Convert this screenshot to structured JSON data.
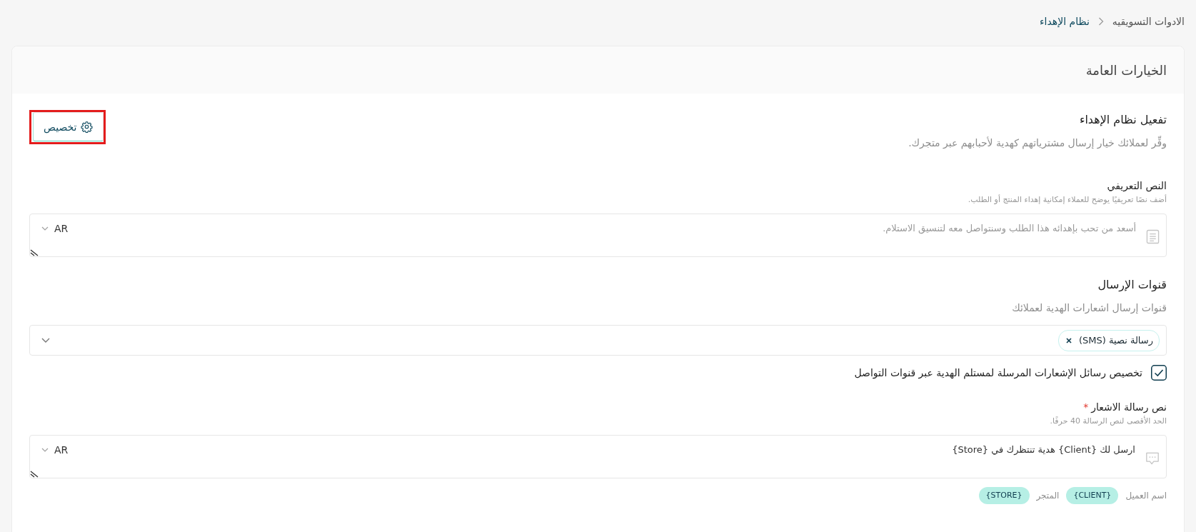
{
  "breadcrumb": [
    {
      "label": "الادوات التسويقيه",
      "current": false
    },
    {
      "label": "نظام الإهداء",
      "current": true
    }
  ],
  "card": {
    "title": "الخيارات العامة"
  },
  "activation": {
    "title": "تفعيل نظام الإهداء",
    "description": "وفِّر لعملائك خيار إرسال مشترياتهم كهدية لأحبابهم عبر متجرك.",
    "customize_button": {
      "label": "تخصيص",
      "highlighted": true
    }
  },
  "intro_text": {
    "label": "النص التعريفي",
    "hint": "أضف نصًا تعريفيًا يوضح للعملاء إمكانية إهداء المنتج أو الطلب.",
    "placeholder": "أسعد من تحب بإهدائه هذا الطلب وسنتواصل معه لتنسيق الاستلام.",
    "language": "AR"
  },
  "channels": {
    "title": "قنوات الإرسال",
    "description": "قنوات إرسال اشعارات الهدية لعملائك",
    "selected_tags": [
      {
        "label": "رسالة نصية (SMS)"
      }
    ],
    "customize_messages": {
      "label": "تخصيص رسائل الإشعارات المرسلة لمستلم الهدية عبر قنوات التواصل",
      "checked": true
    }
  },
  "notification_text": {
    "label": "نص رسالة الاشعار",
    "required_mark": "*",
    "hint": "الحد الأقصى لنص الرسالة 40 حرفًا.",
    "value": "ارسل لك {Client} هدية تنتظرك في {Store}",
    "language": "AR"
  },
  "variables": [
    {
      "label": "اسم العميل",
      "token": "{CLIENT}"
    },
    {
      "label": "المتجر",
      "token": "{STORE}"
    }
  ]
}
